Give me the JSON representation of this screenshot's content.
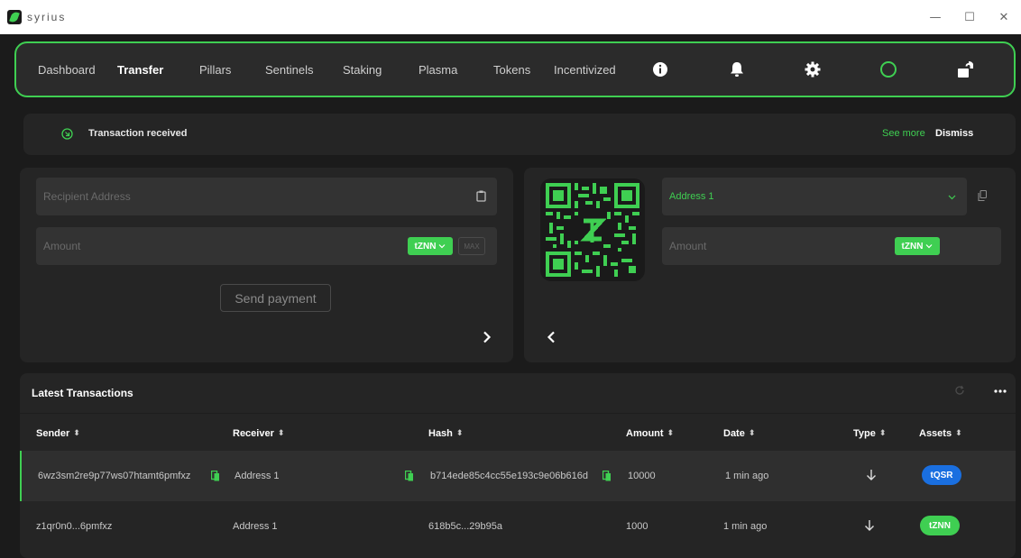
{
  "window": {
    "app_name": "syrius",
    "minimize": "—",
    "maximize": "☐",
    "close": "✕"
  },
  "nav": {
    "items": [
      {
        "label": "Dashboard"
      },
      {
        "label": "Transfer",
        "active": true
      },
      {
        "label": "Pillars"
      },
      {
        "label": "Sentinels"
      },
      {
        "label": "Staking"
      },
      {
        "label": "Plasma"
      },
      {
        "label": "Tokens"
      },
      {
        "label": "Incentivized"
      }
    ],
    "icons": [
      "info-icon",
      "bell-icon",
      "gear-icon",
      "status-ring-icon",
      "unlock-icon"
    ]
  },
  "notification": {
    "text": "Transaction received",
    "see_more": "See more",
    "dismiss": "Dismiss"
  },
  "send": {
    "recipient_placeholder": "Recipient Address",
    "amount_placeholder": "Amount",
    "token": "tZNN",
    "max": "MAX",
    "send_button": "Send payment",
    "next_arrow": "›"
  },
  "receive": {
    "address": "Address 1",
    "amount_placeholder": "Amount",
    "token": "tZNN",
    "back_arrow": "‹"
  },
  "transactions": {
    "title": "Latest Transactions",
    "columns": [
      "Sender",
      "Receiver",
      "Hash",
      "Amount",
      "Date",
      "Type",
      "Assets"
    ],
    "rows": [
      {
        "sender": "6wz3sm2re9p77ws07htamt6pmfxz",
        "receiver": "Address 1",
        "hash": "b714ede85c4cc55e193c9e06b616d",
        "amount": "10000",
        "date": "1 min ago",
        "type": "receive",
        "asset": "tQSR",
        "asset_color": "#1a6fe0"
      },
      {
        "sender": "z1qr0n0...6pmfxz",
        "receiver": "Address 1",
        "hash": "618b5c...29b95a",
        "amount": "1000",
        "date": "1 min ago",
        "type": "receive",
        "asset": "tZNN",
        "asset_color": "#3fcf52"
      }
    ]
  },
  "colors": {
    "accent": "#3fcf52",
    "background": "#1b1b1b",
    "panel": "#252525"
  }
}
